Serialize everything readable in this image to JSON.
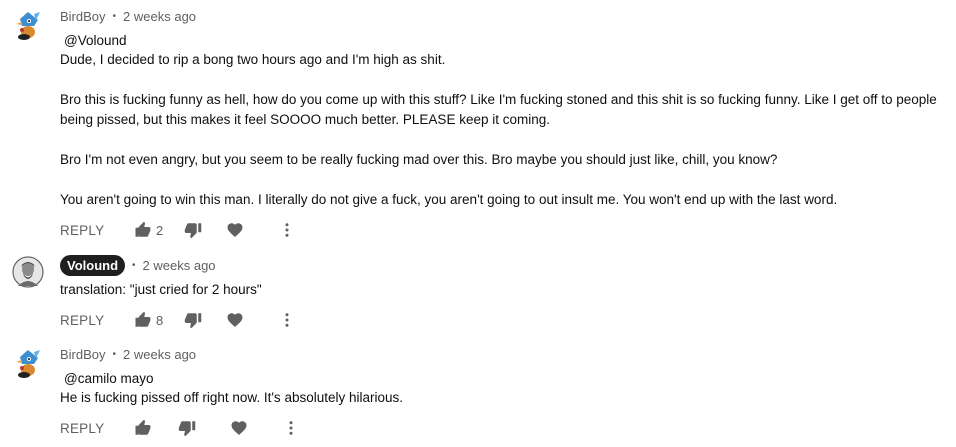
{
  "comments": [
    {
      "author": "BirdBoy",
      "time": "2 weeks ago",
      "mention": "@Volound",
      "paragraphs": [
        "Dude, I decided to rip a bong two hours ago and I'm high as shit.",
        "Bro this is fucking funny as hell, how do you come up with this stuff? Like I'm fucking stoned and this shit is so fucking funny. Like I get off to people being pissed, but this makes it feel SOOOO much better. PLEASE keep it coming.",
        "Bro I'm not even angry, but you seem to be really fucking mad over this. Bro maybe you should just like, chill, you know?",
        "You aren't going to win this man. I literally do not give a fuck, you aren't going to out insult me. You won't end up with the last word."
      ],
      "reply_label": "REPLY",
      "likes": "2"
    },
    {
      "author": "Volound",
      "time": "2 weeks ago",
      "paragraphs": [
        "translation: \"just cried for 2 hours\""
      ],
      "reply_label": "REPLY",
      "likes": "8"
    },
    {
      "author": "BirdBoy",
      "time": "2 weeks ago",
      "mention": "@camilo mayo",
      "paragraphs": [
        "He is fucking pissed off right now. It's absolutely hilarious."
      ],
      "reply_label": "REPLY",
      "likes": ""
    }
  ],
  "separator": "•",
  "icons": {
    "like": "thumbs-up-icon",
    "dislike": "thumbs-down-icon",
    "heart": "heart-icon",
    "more": "more-vertical-icon"
  },
  "colors": {
    "text": "#0f0f0f",
    "secondary": "#606060",
    "badge_bg": "#1f1f1f",
    "icon": "#606060"
  }
}
